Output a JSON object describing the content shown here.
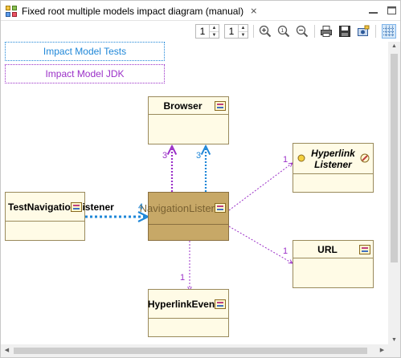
{
  "tab": {
    "title": "Fixed root multiple models impact diagram (manual)",
    "close_glyph": "⨯"
  },
  "toolbar": {
    "spin1": "1",
    "spin2": "1"
  },
  "legend": {
    "tests": "Impact Model Tests",
    "jdk": "Impact Model JDK"
  },
  "colors": {
    "tests": "#1f87d8",
    "jdk": "#9b30c8",
    "box_fill": "#fffbe6",
    "focus_fill": "#c7a867"
  },
  "classes": {
    "browser": "Browser",
    "hyperlink_listener": "Hyperlink Listener",
    "test_navigation_listener": "TestNavigationListener",
    "navigation_listener": "NavigationListener",
    "url": "URL",
    "hyperlink_event": "HyperlinkEvent"
  },
  "labels": {
    "browser_jdk": "3",
    "browser_tests": "3",
    "hyperlink_listener": "1",
    "test_nav": "4",
    "url": "1",
    "hyperlink_event": "1"
  }
}
